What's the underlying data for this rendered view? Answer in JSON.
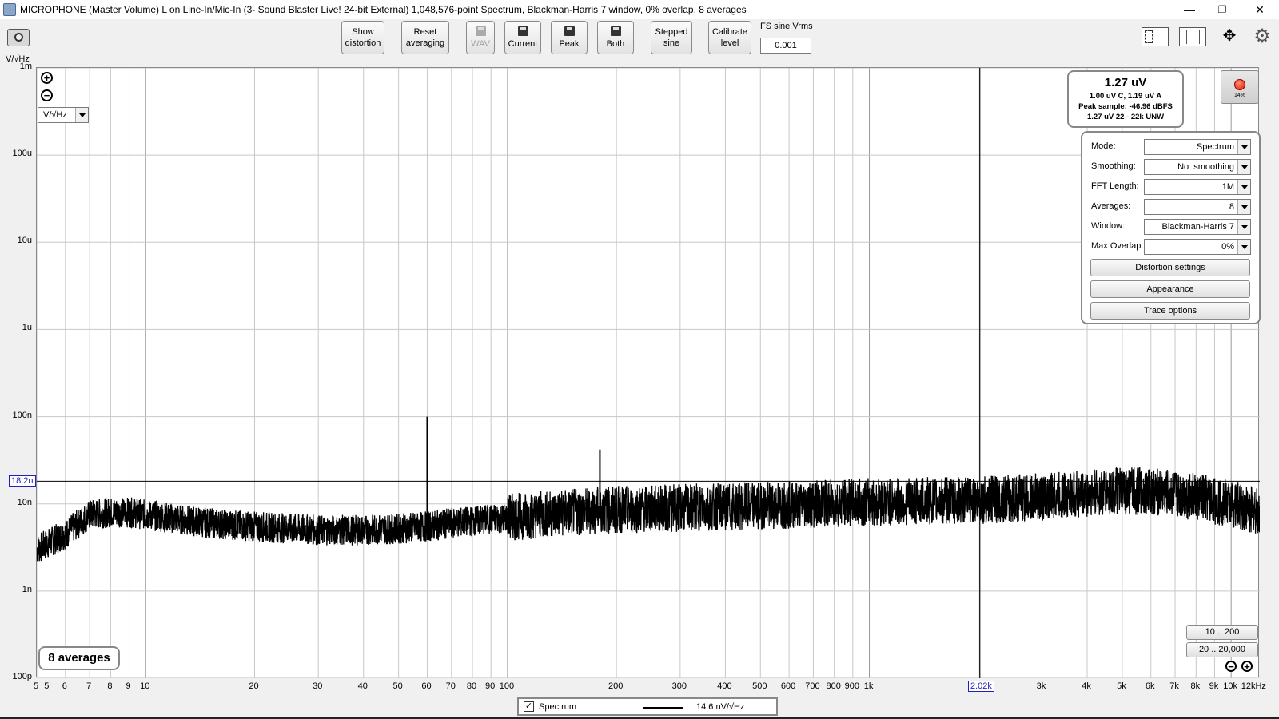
{
  "window": {
    "title": "MICROPHONE (Master Volume) L on Line-In/Mic-In (3- Sound Blaster Live! 24-bit External) 1,048,576-point Spectrum, Blackman-Harris 7 window, 0% overlap, 8 averages",
    "minimize": "—",
    "maximize": "❐",
    "close": "✕"
  },
  "toolbar": {
    "show_distortion": [
      "Show",
      "distortion"
    ],
    "reset_averaging": [
      "Reset",
      "averaging"
    ],
    "wav": "WAV",
    "current": "Current",
    "peak": "Peak",
    "both": "Both",
    "stepped_sine": [
      "Stepped",
      "sine"
    ],
    "calibrate_level": [
      "Calibrate",
      "level"
    ],
    "fs_sine_label": "FS sine Vrms",
    "fs_sine_value": "0.001"
  },
  "plot": {
    "y_unit": "V/√Hz",
    "unit_select": "V/√Hz",
    "y_ticks": [
      "1m",
      "100u",
      "10u",
      "1u",
      "100n",
      "10n",
      "1n",
      "100p"
    ],
    "x_ticks": [
      "5",
      "5",
      "6",
      "7",
      "8",
      "9",
      "10",
      "20",
      "30",
      "40",
      "50",
      "60",
      "70",
      "80",
      "90",
      "100",
      "200",
      "300",
      "400",
      "500",
      "600",
      "700",
      "800",
      "900",
      "1k",
      "3k",
      "4k",
      "5k",
      "6k",
      "7k",
      "8k",
      "9k",
      "10k",
      "12kHz"
    ],
    "cursor_y_label": "18.2n",
    "cursor_x_label": "2.02k",
    "averages_label": "8 averages"
  },
  "readout": {
    "main": "1.27 uV",
    "line1": "1.00 uV C, 1.19 uV A",
    "line2": "Peak sample: -46.96 dBFS",
    "line3": "1.27 uV 22 - 22k UNW"
  },
  "record": {
    "percent": "14%"
  },
  "settings": {
    "rows": [
      {
        "label": "Mode:",
        "value": "Spectrum"
      },
      {
        "label": "Smoothing:",
        "value": "No  smoothing"
      },
      {
        "label": "FFT Length:",
        "value": "1M"
      },
      {
        "label": "Averages:",
        "value": "8"
      },
      {
        "label": "Window:",
        "value": "Blackman-Harris 7"
      },
      {
        "label": "Max Overlap:",
        "value": "0%"
      }
    ],
    "buttons": [
      "Distortion settings",
      "Appearance",
      "Trace options"
    ]
  },
  "ranges": [
    "10 .. 200",
    "20 .. 20,000"
  ],
  "legend": {
    "checked": "✓",
    "name": "Spectrum",
    "value": "14.6 nV/√Hz"
  },
  "chart_data": {
    "type": "line",
    "x_scale": "log",
    "y_scale": "log",
    "xlim": [
      5,
      12000
    ],
    "ylim": [
      1e-10,
      0.001
    ],
    "grid": true,
    "series": [
      {
        "name": "Spectrum",
        "x": [
          5,
          6,
          7,
          8,
          9,
          10,
          15,
          20,
          30,
          40,
          50,
          60,
          70,
          100,
          180,
          200,
          300,
          500,
          1000,
          2000,
          3000,
          4000,
          5000,
          6000,
          7000,
          8000,
          10000,
          12000
        ],
        "y": [
          3e-09,
          4.5e-09,
          7.5e-09,
          8e-09,
          8e-09,
          7.5e-09,
          6e-09,
          5.5e-09,
          5e-09,
          5e-09,
          5.2e-09,
          5.5e-09,
          6e-09,
          7e-09,
          8.5e-09,
          8.5e-09,
          9e-09,
          9.5e-09,
          1.05e-08,
          1.1e-08,
          1.2e-08,
          1.3e-08,
          1.4e-08,
          1.4e-08,
          1.3e-08,
          1.2e-08,
          1e-08,
          8e-09
        ]
      }
    ],
    "peaks": [
      {
        "x": 60,
        "y": 1e-07
      },
      {
        "x": 180,
        "y": 4.2e-08
      }
    ],
    "cursor": {
      "x": 2020,
      "y": 1.82e-08
    }
  }
}
